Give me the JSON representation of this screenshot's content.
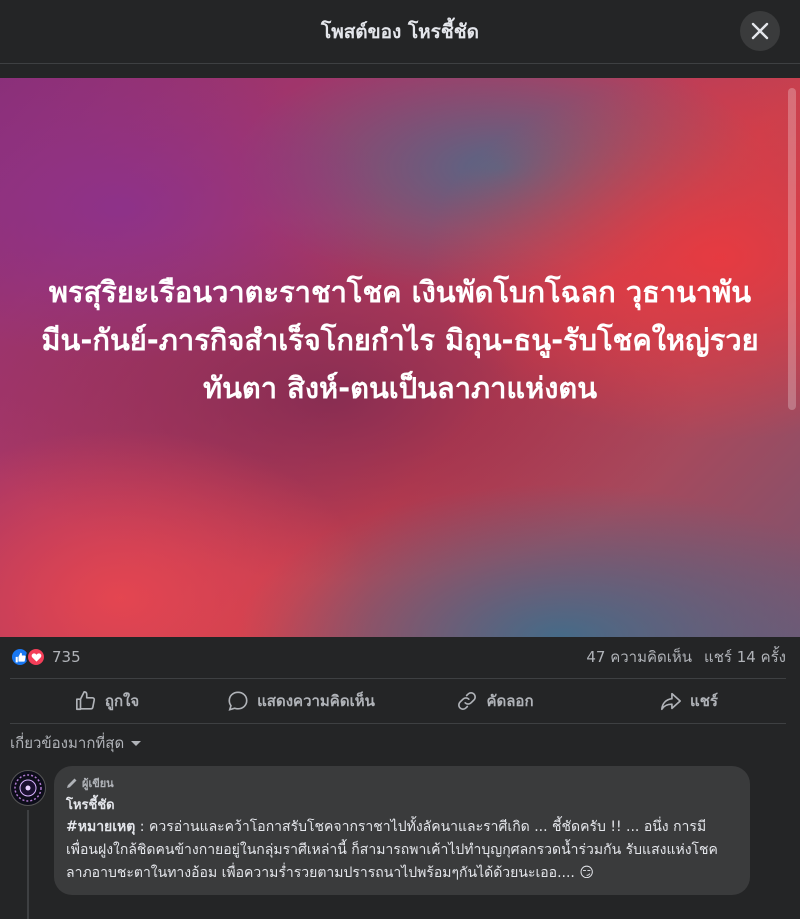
{
  "header": {
    "title": "โพสต์ของ โหรชี้ชัด",
    "close_icon": "close-icon"
  },
  "post": {
    "text": "พรสุริยะเรือนวาตะราชาโชค เงินพัดโบกโฉลก วุธานาพัน มีน-กันย์-ภารกิจสำเร็จโกยกำไร มิถุน-ธนู-รับโชคใหญ่รวยทันตา สิงห์-ตนเป็นลาภาแห่งตน",
    "colors": {
      "red": "#e83a40",
      "purple": "#8a2f79",
      "teal": "#3c6e8c"
    }
  },
  "stats": {
    "reaction_count": "735",
    "reaction_icons": [
      "like-icon",
      "love-icon"
    ],
    "comments": "47 ความคิดเห็น",
    "shares": "แชร์ 14 ครั้ง"
  },
  "actions": {
    "like": "ถูกใจ",
    "comment": "แสดงความคิดเห็น",
    "copy": "คัดลอก",
    "share": "แชร์"
  },
  "sort": {
    "label": "เกี่ยวข้องมากที่สุด"
  },
  "comment": {
    "badge": "ผู้เขียน",
    "author": "โหรชี้ชัด",
    "hashtag": "#หมายเหตุ",
    "text": " : ควรอ่านและคว้าโอกาสรับโชคจากราชาไปทั้งลัคนาและราศีเกิด ... ชี้ชัดครับ !! ... อนึ่ง การมีเพื่อนฝูงใกล้ชิดคนข้างกายอยู่ในกลุ่มราศีเหล่านี้ ก็สามารถพาเค้าไปทำบุญกุศลกรวดน้ำร่วมกัน รับแสงแห่งโชคลาภอาบชะตาในทางอ้อม เพื่อความร่ำรวยตามปรารถนาไปพร้อมๆกันได้ด้วยนะเออ.... 😏"
  }
}
